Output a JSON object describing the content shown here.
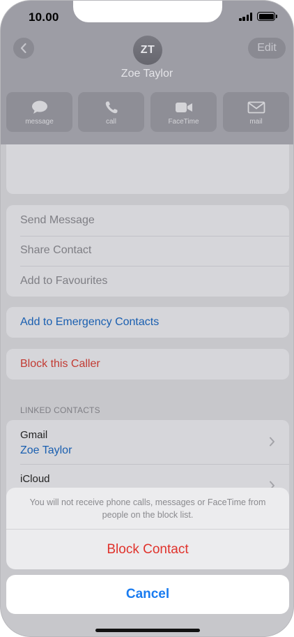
{
  "status_bar": {
    "time": "10.00"
  },
  "header": {
    "edit_label": "Edit",
    "avatar_initials": "ZT",
    "contact_name": "Zoe Taylor",
    "actions": [
      {
        "label": "message",
        "icon": "message-bubble-icon"
      },
      {
        "label": "call",
        "icon": "phone-icon"
      },
      {
        "label": "FaceTime",
        "icon": "video-camera-icon"
      },
      {
        "label": "mail",
        "icon": "envelope-icon"
      }
    ]
  },
  "options": {
    "send_message": "Send Message",
    "share_contact": "Share Contact",
    "add_to_favourites": "Add to Favourites"
  },
  "emergency": {
    "label": "Add to Emergency Contacts"
  },
  "block_caller": {
    "label": "Block this Caller"
  },
  "linked_contacts": {
    "header": "LINKED CONTACTS",
    "items": [
      {
        "service": "Gmail",
        "name": "Zoe Taylor"
      },
      {
        "service": "iCloud",
        "name": ""
      }
    ]
  },
  "action_sheet": {
    "message": "You will not receive phone calls, messages or FaceTime from people on the block list.",
    "block_label": "Block Contact",
    "cancel_label": "Cancel"
  },
  "colors": {
    "blue_link": "#1a5fb0",
    "destructive_red": "#e0322b",
    "cancel_blue": "#1a7cf0",
    "dim_overlay": "#9d9da5"
  }
}
